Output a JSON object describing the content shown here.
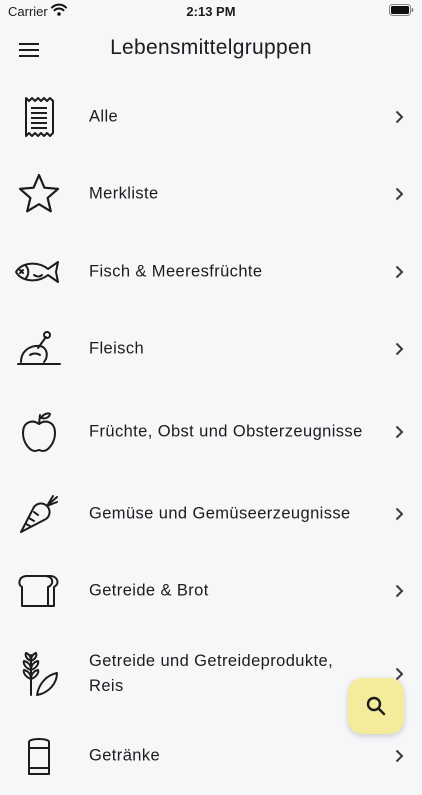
{
  "status_bar": {
    "carrier": "Carrier",
    "time": "2:13 PM"
  },
  "header": {
    "title": "Lebensmittelgruppen",
    "menu_icon": "hamburger-menu-icon"
  },
  "categories": [
    {
      "label": "Alle",
      "icon": "document-list-icon"
    },
    {
      "label": "Merkliste",
      "icon": "star-icon"
    },
    {
      "label": "Fisch & Meeresfrüchte",
      "icon": "fish-icon"
    },
    {
      "label": "Fleisch",
      "icon": "roast-chicken-icon"
    },
    {
      "label": "Früchte, Obst und Obsterzeugnisse",
      "icon": "apple-icon"
    },
    {
      "label": "Gemüse und Gemüseerzeugnisse",
      "icon": "carrot-icon"
    },
    {
      "label": "Getreide & Brot",
      "icon": "bread-icon"
    },
    {
      "label": "Getreide und Getreideprodukte, Reis",
      "icon": "grain-icon"
    },
    {
      "label": "Getränke",
      "icon": "can-icon"
    }
  ],
  "search_button": {
    "icon": "search-icon",
    "color": "#f4ec9a"
  }
}
